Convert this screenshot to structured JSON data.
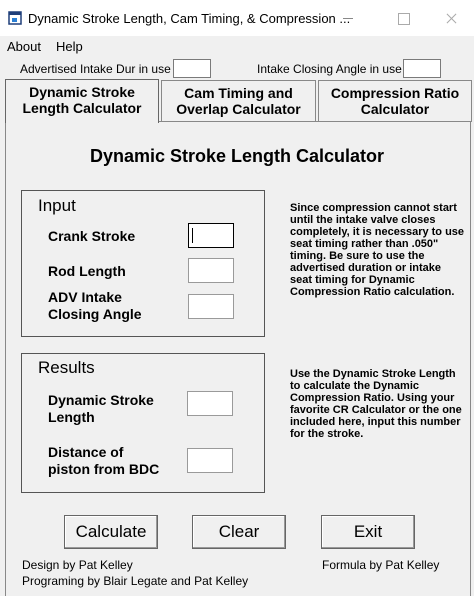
{
  "window": {
    "title": "Dynamic Stroke Length, Cam Timing, & Compression ..."
  },
  "menu": {
    "items": [
      "About",
      "Help"
    ]
  },
  "intake": {
    "advertised_label": "Advertised Intake Dur in use",
    "advertised_value": "",
    "closing_label": "Intake Closing Angle in use",
    "closing_value": ""
  },
  "tabs": [
    {
      "line1": "Dynamic Stroke",
      "line2": "Length Calculator"
    },
    {
      "line1": "Cam Timing and",
      "line2": "Overlap Calculator"
    },
    {
      "line1": "Compression Ratio",
      "line2": "Calculator"
    }
  ],
  "panel": {
    "title": "Dynamic Stroke Length Calculator",
    "input_group": {
      "title": "Input",
      "fields": [
        {
          "label_lines": [
            "Crank Stroke"
          ],
          "value": ""
        },
        {
          "label_lines": [
            "Rod Length"
          ],
          "value": ""
        },
        {
          "label_lines": [
            "ADV Intake",
            "Closing Angle"
          ],
          "value": ""
        }
      ]
    },
    "results_group": {
      "title": "Results",
      "fields": [
        {
          "label_lines": [
            "Dynamic Stroke",
            "Length"
          ],
          "value": ""
        },
        {
          "label_lines": [
            "Distance of",
            "piston from BDC"
          ],
          "value": ""
        }
      ]
    },
    "note_input": "Since compression cannot start until the intake valve closes completely, it is necessary to use seat timing rather than .050\" timing. Be sure to use the advertised duration or intake seat timing for Dynamic Compression Ratio calculation.",
    "note_results": "Use the Dynamic Stroke Length to calculate the Dynamic Compression Ratio. Using your favorite CR Calculator or the one included here, input this number for the stroke.",
    "buttons": {
      "calculate": "Calculate",
      "clear": "Clear",
      "exit": "Exit"
    },
    "credits": {
      "design": "Design  by Pat Kelley",
      "programming": "Programing by Blair Legate and Pat Kelley",
      "formula": "Formula by Pat Kelley"
    }
  }
}
